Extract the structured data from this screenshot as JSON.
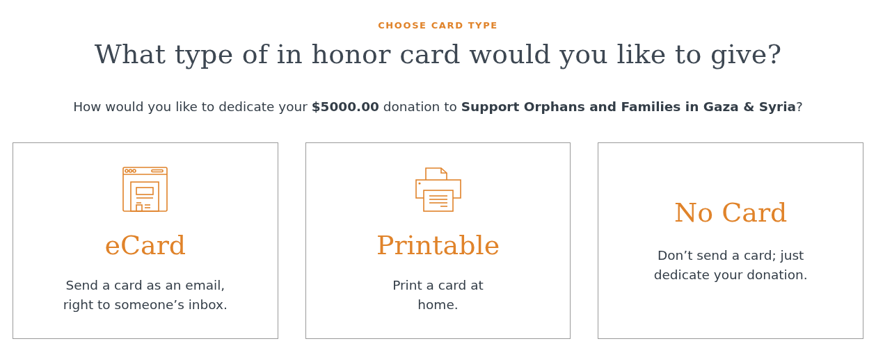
{
  "eyebrow": "CHOOSE CARD TYPE",
  "heading": "What type of in honor card would you like to give?",
  "intro": "How would you like to dedicate your **$5000.00** donation to **Support Orphans and Families in Gaza & Syria**?",
  "cards": [
    {
      "kind": "ecard",
      "title": "eCard",
      "description": "Send a card as an email,\nright to someone’s inbox."
    },
    {
      "kind": "printable",
      "title": "Printable",
      "description": "Print a card at\nhome."
    },
    {
      "kind": "none",
      "title": "No Card",
      "description": "Don’t send a card; just\ndedicate your donation."
    }
  ]
}
